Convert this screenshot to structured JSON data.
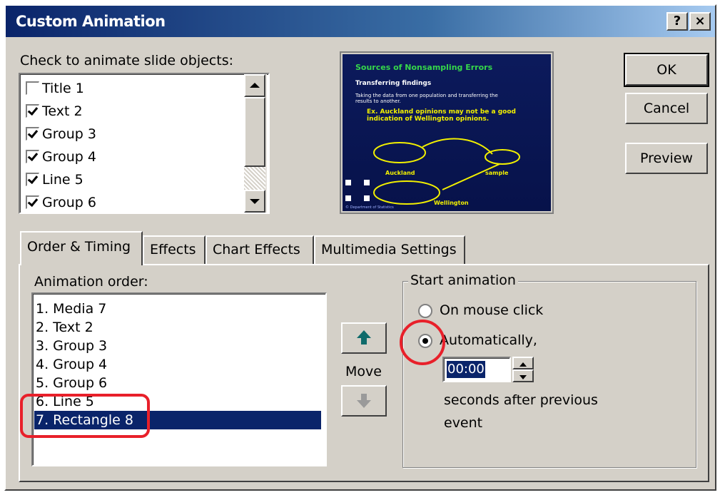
{
  "window": {
    "title": "Custom Animation",
    "help_button": "?",
    "close_button": "×"
  },
  "objects": {
    "label": "Check to animate slide objects:",
    "items": [
      {
        "label": "Title 1",
        "checked": false
      },
      {
        "label": "Text 2",
        "checked": true
      },
      {
        "label": "Group 3",
        "checked": true
      },
      {
        "label": "Group 4",
        "checked": true
      },
      {
        "label": "Line 5",
        "checked": true
      },
      {
        "label": "Group 6",
        "checked": true
      }
    ]
  },
  "slide_preview": {
    "title": "Sources of Nonsampling Errors",
    "subtitle": "Transferring findings",
    "body": "Taking the data from one population and transferring the results to another.",
    "highlight": "Ex. Auckland opinions may not be a good indication of Wellington opinions.",
    "labels": [
      "Auckland",
      "sample",
      "Wellington"
    ],
    "footer": "© Department of Statistics",
    "colors": {
      "background": "#0c1a5c",
      "title": "#35d64a",
      "text": "#ffffff",
      "highlight": "#f2f000"
    }
  },
  "buttons": {
    "ok": "OK",
    "cancel": "Cancel",
    "preview": "Preview"
  },
  "tabs": [
    {
      "label": "Order & Timing",
      "active": true
    },
    {
      "label": "Effects",
      "active": false
    },
    {
      "label": "Chart Effects",
      "active": false
    },
    {
      "label": "Multimedia Settings",
      "active": false
    }
  ],
  "animation_order": {
    "label": "Animation order:",
    "items": [
      "1. Media 7",
      "2. Text 2",
      "3. Group 3",
      "4. Group 4",
      "5. Group 6",
      "6. Line 5",
      "7. Rectangle 8"
    ],
    "selected_index": 6
  },
  "move": {
    "label": "Move",
    "up_icon": "arrow-up-icon",
    "down_icon": "arrow-down-icon"
  },
  "start_animation": {
    "label": "Start animation",
    "options": [
      {
        "label": "On mouse click",
        "selected": false
      },
      {
        "label": "Automatically,",
        "selected": true
      }
    ],
    "time_value": "00:00",
    "after_text": "seconds after previous",
    "after_text2": "event"
  },
  "annotation_color": "#e8202a"
}
